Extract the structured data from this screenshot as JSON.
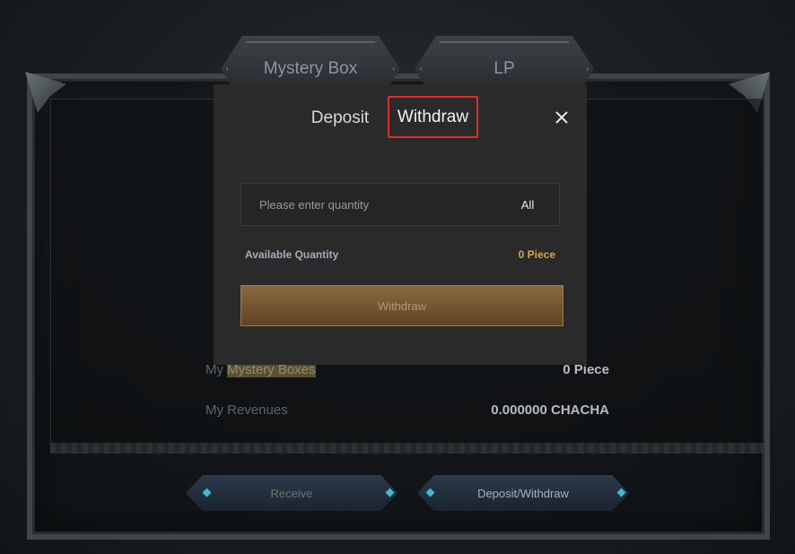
{
  "background": {
    "tabs": [
      "Mystery Box",
      "LP"
    ],
    "rows": [
      {
        "label_plain": "My ",
        "label_highlight": "Mystery Boxes",
        "value": "0 Piece"
      },
      {
        "label": "My Revenues",
        "value": "0.000000 CHACHA"
      }
    ],
    "buttons": {
      "receive": "Receive",
      "deposit_withdraw": "Deposit/Withdraw"
    }
  },
  "modal": {
    "tabs": {
      "deposit": "Deposit",
      "withdraw": "Withdraw"
    },
    "active_tab": "withdraw",
    "quantity": {
      "placeholder": "Please enter quantity",
      "value": "",
      "all_label": "All"
    },
    "available": {
      "label": "Available Quantity",
      "value": "0 Piece"
    },
    "submit_label": "Withdraw"
  },
  "colors": {
    "highlight_box": "#e52b2b",
    "accent_gold": "#d6a64b",
    "button_brown": "#7a5a32"
  }
}
